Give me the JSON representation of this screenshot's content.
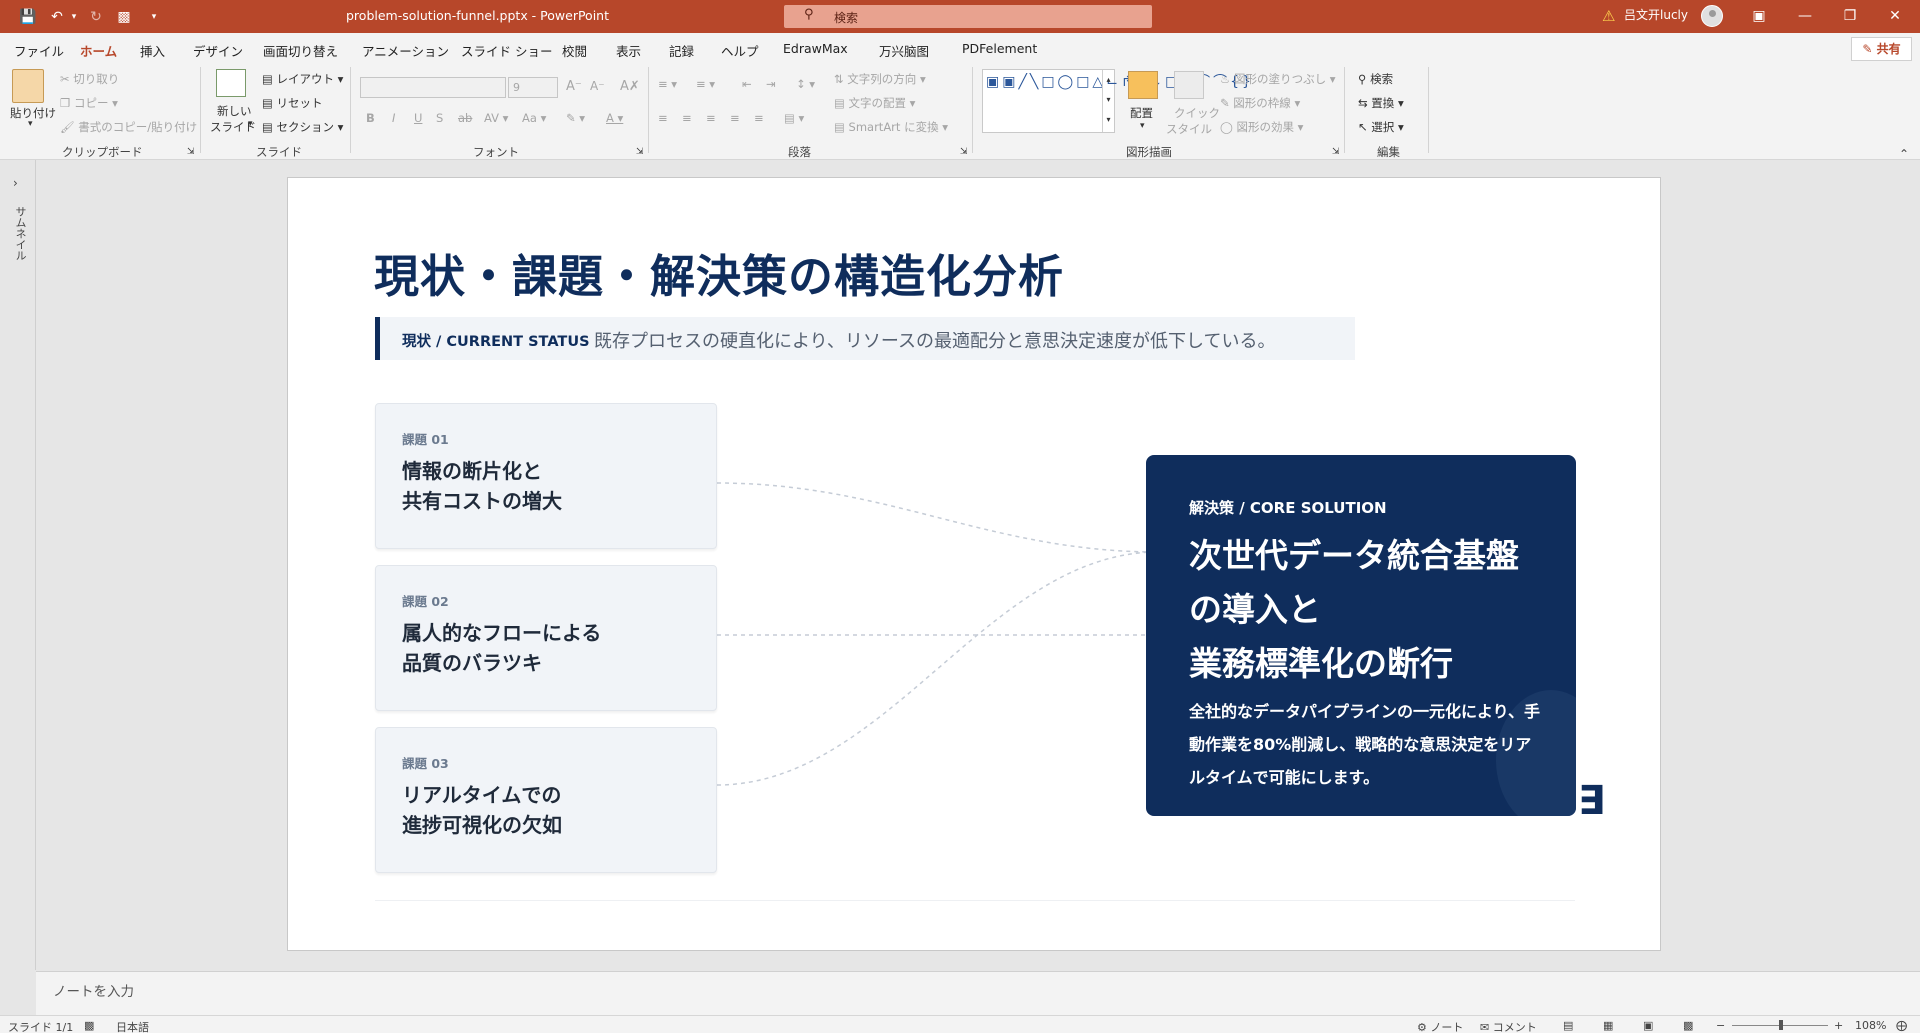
{
  "app": {
    "doc_title": "problem-solution-funnel.pptx  -  PowerPoint",
    "search_placeholder": "検索",
    "user_name": "吕文开lucly"
  },
  "menu": {
    "tabs": [
      "ファイル",
      "ホーム",
      "挿入",
      "デザイン",
      "画面切り替え",
      "アニメーション",
      "スライド ショー",
      "校閲",
      "表示",
      "記録",
      "ヘルプ",
      "EdrawMax",
      "万兴脑图",
      "PDFelement"
    ],
    "active_tab": "ホーム",
    "share_label": "共有"
  },
  "ribbon": {
    "clipboard": {
      "paste": "貼り付け",
      "cut": "切り取り",
      "copy": "コピー",
      "format_painter": "書式のコピー/貼り付け",
      "label": "クリップボード"
    },
    "slides": {
      "new_slide_1": "新しい",
      "new_slide_2": "スライド",
      "layout": "レイアウト",
      "reset": "リセット",
      "section": "セクション",
      "label": "スライド"
    },
    "font": {
      "size": "9",
      "label": "フォント"
    },
    "paragraph": {
      "text_direction": "文字列の方向",
      "align_text": "文字の配置",
      "smartart": "SmartArt に変換",
      "label": "段落"
    },
    "drawing": {
      "arrange": "配置",
      "quick_styles_1": "クイック",
      "quick_styles_2": "スタイル",
      "shape_fill": "図形の塗りつぶし",
      "shape_outline": "図形の枠線",
      "shape_effects": "図形の効果",
      "label": "図形描画"
    },
    "editing": {
      "find": "検索",
      "replace": "置換",
      "select": "選択",
      "label": "編集"
    }
  },
  "thumbnail_pane": {
    "label": "サムネイル"
  },
  "slide": {
    "title": "現状・課題・解決策の構造化分析",
    "status_label": "現状 / CURRENT STATUS",
    "status_text": "既存プロセスの硬直化により、リソースの最適配分と意思決定速度が低下している。",
    "problems": [
      {
        "num": "課題 01",
        "text": "情報の断片化と\n 共有コストの増大"
      },
      {
        "num": "課題 02",
        "text": "属人的なフローによる\n 品質のバラツキ"
      },
      {
        "num": "課題 03",
        "text": "リアルタイムでの\n 進捗可視化の欠如"
      }
    ],
    "solution": {
      "label": "解決策 / CORE SOLUTION",
      "title": "次世代データ統合基盤\nの導入と\n 業務標準化の断行",
      "desc": "全社的なデータパイプラインの一元化により、手動作業を80%削減し、戦略的な意思決定をリアルタイムで可能にします。"
    },
    "deco_glyph": "∃"
  },
  "notes": {
    "placeholder": "ノートを入力"
  },
  "statusbar": {
    "slide_info": "スライド 1/1",
    "language": "日本語",
    "notes": "ノート",
    "comments": "コメント",
    "zoom_minus": "−",
    "zoom_plus": "+",
    "zoom": "108%"
  },
  "colors": {
    "accent": "#b7472a",
    "navy": "#0f2d5c"
  }
}
